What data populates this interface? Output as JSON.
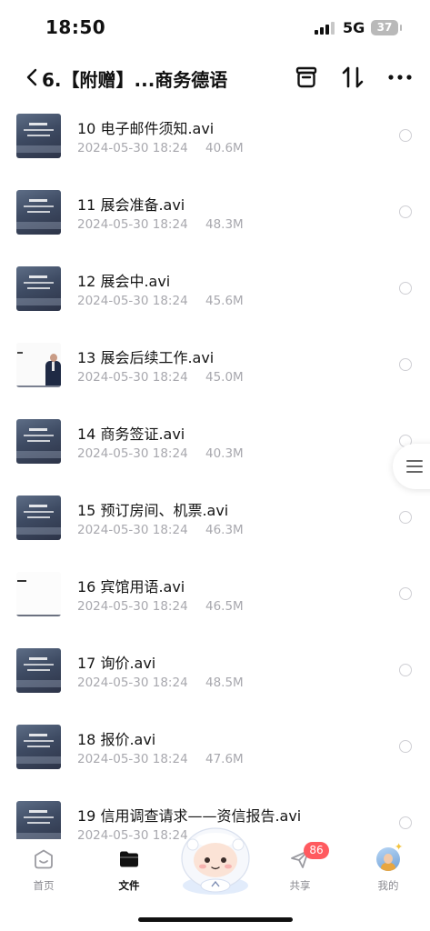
{
  "status_bar": {
    "time": "18:50",
    "network": "5G",
    "battery": "37"
  },
  "nav": {
    "title": "6.【附赠】...商务德语"
  },
  "files": [
    {
      "name": "10 电子邮件须知.avi",
      "date": "2024-05-30 18:24",
      "size": "40.6M",
      "thumb": "slide"
    },
    {
      "name": "11 展会准备.avi",
      "date": "2024-05-30 18:24",
      "size": "48.3M",
      "thumb": "slide"
    },
    {
      "name": "12 展会中.avi",
      "date": "2024-05-30 18:24",
      "size": "45.6M",
      "thumb": "slide"
    },
    {
      "name": "13 展会后续工作.avi",
      "date": "2024-05-30 18:24",
      "size": "45.0M",
      "thumb": "photo"
    },
    {
      "name": "14 商务签证.avi",
      "date": "2024-05-30 18:24",
      "size": "40.3M",
      "thumb": "slide"
    },
    {
      "name": "15 预订房间、机票.avi",
      "date": "2024-05-30 18:24",
      "size": "46.3M",
      "thumb": "slide"
    },
    {
      "name": "16 宾馆用语.avi",
      "date": "2024-05-30 18:24",
      "size": "46.5M",
      "thumb": "blank"
    },
    {
      "name": "17 询价.avi",
      "date": "2024-05-30 18:24",
      "size": "48.5M",
      "thumb": "slide"
    },
    {
      "name": "18 报价.avi",
      "date": "2024-05-30 18:24",
      "size": "47.6M",
      "thumb": "slide"
    },
    {
      "name": "19 信用调查请求——资信报告.avi",
      "date": "2024-05-30 18:24",
      "size": "",
      "thumb": "slide"
    }
  ],
  "tabs": [
    {
      "label": "首页",
      "icon": "home-face-icon"
    },
    {
      "label": "文件",
      "icon": "folder-icon",
      "active": true
    },
    {
      "label": "共享",
      "icon": "paper-plane-icon",
      "badge": "86"
    },
    {
      "label": "我的",
      "icon": "avatar"
    }
  ],
  "colors": {
    "accent_badge": "#ff5a5f",
    "meta_text": "#a8a8ae",
    "select_border": "#cfcfd4"
  }
}
